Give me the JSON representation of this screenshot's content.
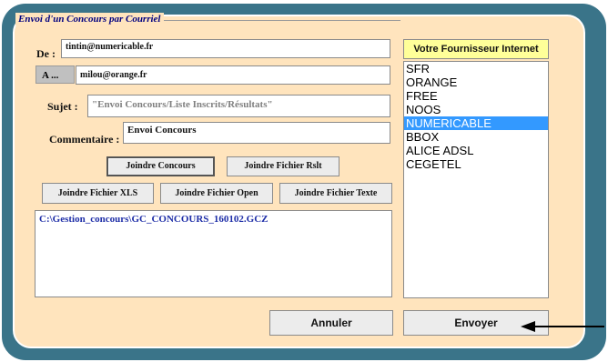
{
  "dialog": {
    "title": "Envoi d'un Concours par Courriel"
  },
  "form": {
    "de_label": "De :",
    "de_value": "tintin@numericable.fr",
    "a_label": "A ...",
    "a_value": "milou@orange.fr",
    "sujet_label": "Sujet :",
    "sujet_value": "\"Envoi Concours/Liste Inscrits/Résultats\"",
    "commentaire_label": "Commentaire :",
    "commentaire_value": "Envoi Concours"
  },
  "buttons": {
    "joindre_concours": "Joindre Concours",
    "joindre_fichier_rslt": "Joindre Fichier Rslt",
    "joindre_fichier_xls": "Joindre Fichier XLS",
    "joindre_fichier_open": "Joindre Fichier Open",
    "joindre_fichier_texte": "Joindre Fichier Texte",
    "annuler": "Annuler",
    "envoyer": "Envoyer"
  },
  "attachments": [
    "C:\\Gestion_concours\\GC_CONCOURS_160102.GCZ"
  ],
  "providers": {
    "header": "Votre Fournisseur Internet",
    "items": [
      "SFR",
      "ORANGE",
      "FREE",
      "NOOS",
      "NUMERICABLE",
      "BBOX",
      "ALICE ADSL",
      "CEGETEL"
    ],
    "selected": "NUMERICABLE"
  },
  "colors": {
    "outer": "#3a7489",
    "panel": "#ffe4bd",
    "selection": "#3399ff",
    "provider_header": "#ffff99",
    "attachment_text": "#1f2fa8"
  },
  "icons": {
    "send_indicator": "left-arrow-icon"
  }
}
